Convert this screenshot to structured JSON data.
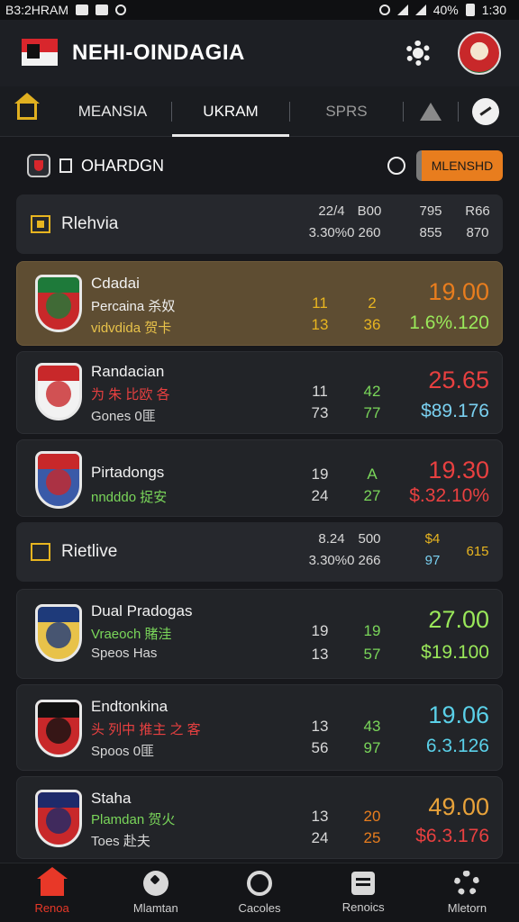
{
  "status_bar": {
    "left_text": "B3:2HRAM",
    "battery": "40%",
    "time": "1:30"
  },
  "header": {
    "title": "NEHI-OINDAGIA"
  },
  "tabs": [
    "MEANSIA",
    "UKRAM",
    "SPRS"
  ],
  "section": {
    "label": "OHARDGN",
    "button": "MLENSHD"
  },
  "groups": [
    {
      "name": "Rlehvia",
      "col1": [
        "22/4",
        "3.30%0"
      ],
      "col2": [
        "B00",
        "260"
      ],
      "col3": [
        "795",
        "855"
      ],
      "col4": [
        "R66",
        "870"
      ]
    },
    {
      "name": "Rietlive",
      "col1": [
        "8.24",
        "3.30%0"
      ],
      "col2": [
        "500",
        "266"
      ],
      "col3": [
        "$4",
        "97"
      ],
      "col4": [
        "",
        "615"
      ]
    }
  ],
  "matches": [
    {
      "team1": "Cdadai",
      "team2": "Percaina 杀奴",
      "team3": "vidvdida 贺卡",
      "n1": "11",
      "n2": "13",
      "m1": "2",
      "m2": "36",
      "odds": "19.00",
      "sub": "1.6%.120",
      "colors": {
        "badge_top": "#1e7a3a",
        "badge_body": "#c8282a",
        "team2": "#f0f0f0",
        "team3": "#e8c24a",
        "n": "#e8b520",
        "m1": "#e8b520",
        "m2": "#e8b520",
        "odds": "#e87d1e",
        "sub": "#9ae85a"
      }
    },
    {
      "team1": "Randacian",
      "team2": "为 朱 比欧 各",
      "team3": "Gones 0匪",
      "n1": "11",
      "n2": "73",
      "m1": "42",
      "m2": "77",
      "odds": "25.65",
      "sub": "$89.176",
      "colors": {
        "badge_top": "#c8282a",
        "badge_body": "#f2f2f2",
        "team2": "#e84040",
        "team3": "#d8d8d8",
        "n": "#d8d8d8",
        "m1": "#7ad65a",
        "m2": "#7ad65a",
        "odds": "#e84040",
        "sub": "#7ad0f0"
      }
    },
    {
      "team1": "Pirtadongs",
      "team2": "nndddo 捉安",
      "team3": "",
      "n1": "19",
      "n2": "24",
      "m1": "A",
      "m2": "27",
      "odds": "19.30",
      "sub": "$.32.10%",
      "colors": {
        "badge_top": "#c8282a",
        "badge_body": "#3a5aa8",
        "team2": "#7ad65a",
        "team3": "#d8d8d8",
        "n": "#d8d8d8",
        "m1": "#7ad65a",
        "m2": "#7ad65a",
        "odds": "#e84040",
        "sub": "#e84040"
      }
    },
    {
      "team1": "Dual Pradogas",
      "team2": "Vraeoch 賭洼",
      "team3": "Speos Has",
      "n1": "19",
      "n2": "13",
      "m1": "19",
      "m2": "57",
      "odds": "27.00",
      "sub": "$19.100",
      "colors": {
        "badge_top": "#1e3a7a",
        "badge_body": "#e8c24a",
        "team2": "#7ad65a",
        "team3": "#d8d8d8",
        "n": "#d8d8d8",
        "m1": "#7ad65a",
        "m2": "#7ad65a",
        "odds": "#9ae85a",
        "sub": "#9ae85a"
      }
    },
    {
      "team1": "Endtonkina",
      "team2": "头 列中 推主 之 客",
      "team3": "Spoos 0匪",
      "n1": "13",
      "n2": "56",
      "m1": "43",
      "m2": "97",
      "odds": "19.06",
      "sub": "6.3.126",
      "colors": {
        "badge_top": "#111111",
        "badge_body": "#c8282a",
        "team2": "#e84040",
        "team3": "#d8d8d8",
        "n": "#d8d8d8",
        "m1": "#7ad65a",
        "m2": "#7ad65a",
        "odds": "#5ad0e8",
        "sub": "#5ad0e8"
      }
    },
    {
      "team1": "Staha",
      "team2": "Plamdan 贺火",
      "team3": "Toes 赴夫",
      "n1": "13",
      "n2": "24",
      "m1": "20",
      "m2": "25",
      "odds": "49.00",
      "sub": "$6.3.176",
      "colors": {
        "badge_top": "#1e2a6a",
        "badge_body": "#c8282a",
        "team2": "#7ad65a",
        "team3": "#d8d8d8",
        "n": "#d8d8d8",
        "m1": "#e87d1e",
        "m2": "#e87d1e",
        "odds": "#e8a23a",
        "sub": "#e84040"
      }
    }
  ],
  "bottom_nav": [
    "Renoa",
    "Mlamtan",
    "Cacoles",
    "Renoics",
    "Mletorn"
  ]
}
